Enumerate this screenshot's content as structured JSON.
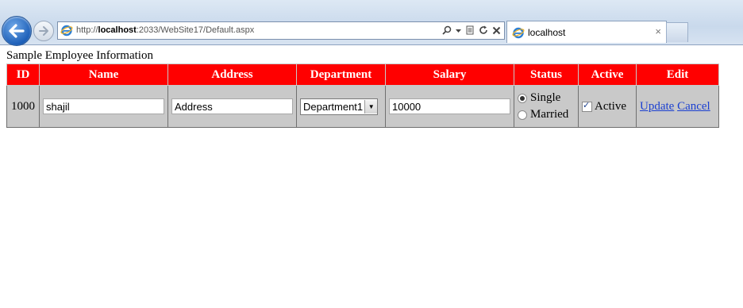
{
  "browser": {
    "url_prefix": "http://",
    "url_host": "localhost",
    "url_rest": ":2033/WebSite17/Default.aspx",
    "tab_title": "localhost",
    "tab_close": "×",
    "address_icons": [
      "search-icon",
      "dropdown-icon",
      "compatibility-icon",
      "refresh-icon",
      "stop-icon"
    ]
  },
  "page": {
    "title": "Sample Employee Information"
  },
  "grid": {
    "columns": [
      "ID",
      "Name",
      "Address",
      "Department",
      "Salary",
      "Status",
      "Active",
      "Edit"
    ],
    "row": {
      "id": "1000",
      "name": "shajil",
      "address": "Address",
      "department": "Department1",
      "salary": "10000",
      "status_options": [
        "Single",
        "Married"
      ],
      "status_selected": "Single",
      "active_label": "Active",
      "active_checked": true,
      "update_label": "Update",
      "cancel_label": "Cancel"
    }
  },
  "colors": {
    "header_bg": "#ff0000",
    "header_text": "#ffffff",
    "row_bg": "#c9c9c9",
    "link": "#1a3fd1"
  }
}
